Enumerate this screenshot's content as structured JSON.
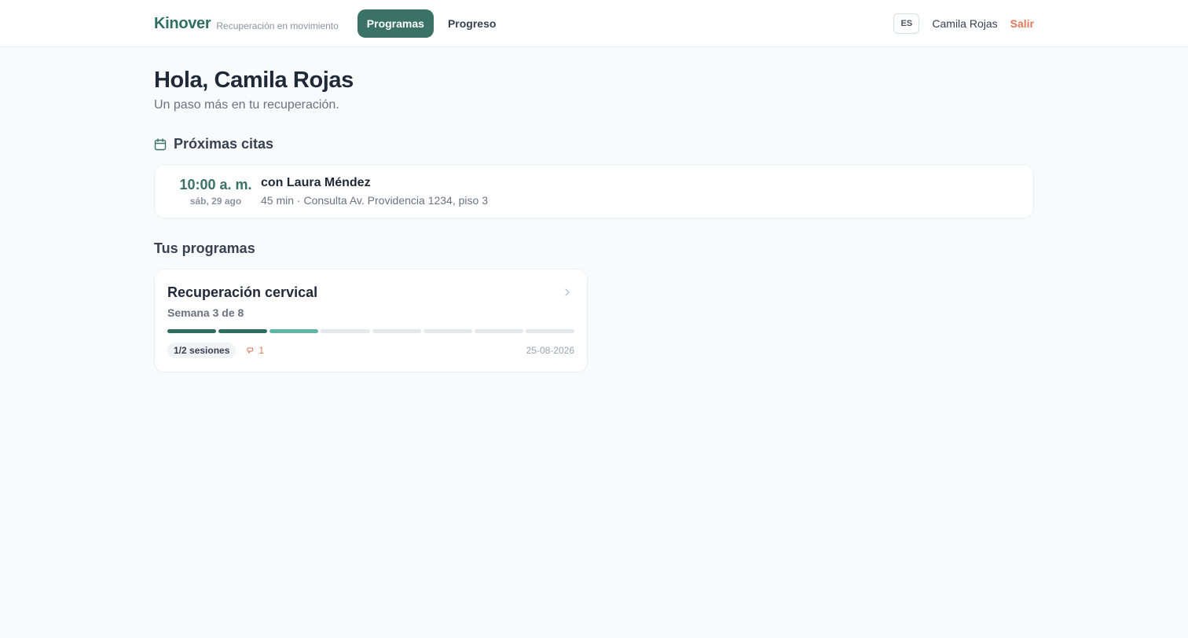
{
  "header": {
    "brand": "Kinover",
    "tagline": "Recuperación en movimiento",
    "nav": [
      {
        "label": "Programas",
        "active": true
      },
      {
        "label": "Progreso",
        "active": false
      }
    ],
    "language": "ES",
    "user_name": "Camila Rojas",
    "logout_label": "Salir"
  },
  "main": {
    "greeting": "Hola, Camila Rojas",
    "subtitle": "Un paso más en tu recuperación.",
    "appointments_title": "Próximas citas",
    "appointments_icon": "calendar-icon",
    "appointments": [
      {
        "time": "10:00 a. m.",
        "date": "sáb, 29 ago",
        "with": "con Laura Méndez",
        "details": "45 min · Consulta Av. Providencia 1234, piso 3"
      }
    ],
    "programs_title": "Tus programas",
    "programs": [
      {
        "name": "Recuperación cervical",
        "week_label": "Semana 3 de 8",
        "current_week": 3,
        "total_weeks": 8,
        "sessions_badge": "1/2 sesiones",
        "pain_icon": "alert-icon",
        "pain_count": "1",
        "date": "25-08-2026"
      }
    ]
  },
  "colors": {
    "brand": "#2f6f62",
    "accent": "#3a7366",
    "progress_done": "#2f6f62",
    "progress_current": "#5fb5a4",
    "progress_empty": "#e5e7eb",
    "logout": "#e0785b"
  }
}
